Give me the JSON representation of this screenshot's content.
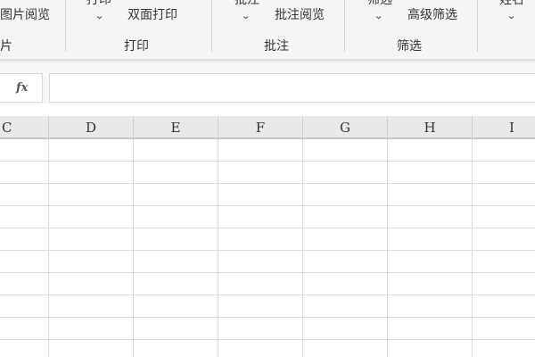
{
  "ribbon": {
    "picture_group": {
      "button_label": "图片阅览",
      "group_label": "片"
    },
    "print_group": {
      "print_label": "打印",
      "duplex_label": "双面打印",
      "group_label": "打印"
    },
    "comment_group": {
      "comment_label": "批注",
      "review_label": "批注阅览",
      "group_label": "批注"
    },
    "filter_group": {
      "filter_label": "筛选",
      "advanced_label": "高级筛选",
      "group_label": "筛选"
    },
    "name_group": {
      "name_label": "姓名"
    }
  },
  "formula_bar": {
    "fx_label": "fx",
    "value": ""
  },
  "sheet": {
    "columns": [
      "C",
      "D",
      "E",
      "F",
      "G",
      "H",
      "I"
    ],
    "cells": []
  },
  "colors": {
    "ribbon_bg": "#f5f5f5",
    "header_bg": "#e9e9e9",
    "gridline": "#dadada",
    "text": "#333333"
  },
  "icons": {
    "dropdown": "chevron-down-icon",
    "formula": "fx-icon"
  }
}
